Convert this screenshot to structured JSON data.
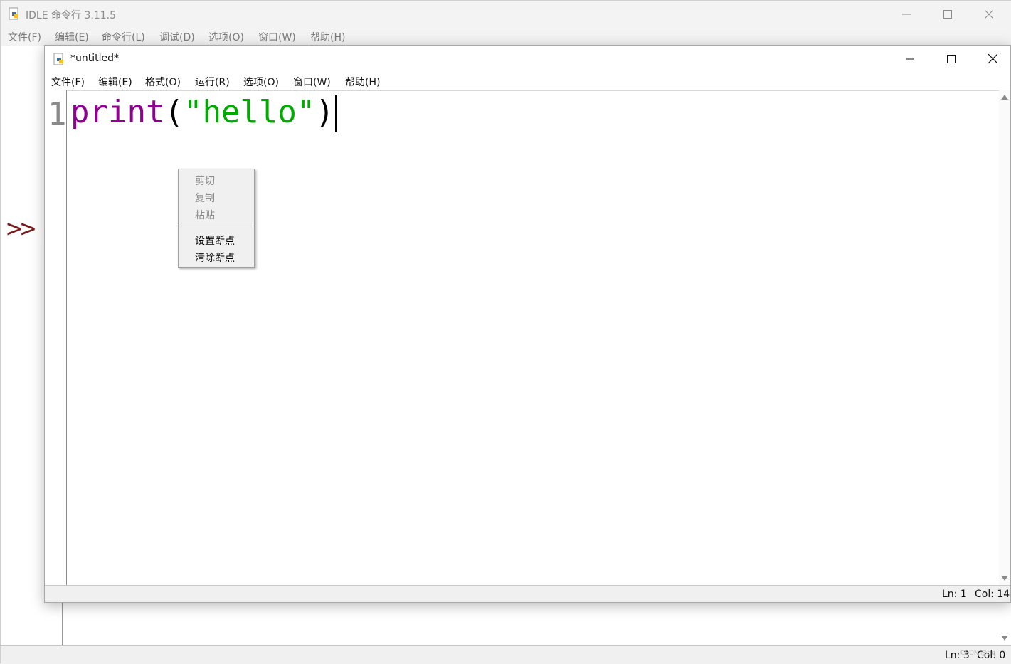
{
  "shell_window": {
    "title": "IDLE 命令行 3.11.5",
    "menu": [
      "文件(F)",
      "编辑(E)",
      "命令行(L)",
      "调试(D)",
      "选项(O)",
      "窗口(W)",
      "帮助(H)"
    ],
    "prompt": ">>",
    "status": {
      "ln": "Ln: 3",
      "col": "Col: 0"
    }
  },
  "editor_window": {
    "title": "*untitled*",
    "menu": [
      "文件(F)",
      "编辑(E)",
      "格式(O)",
      "运行(R)",
      "选项(O)",
      "窗口(W)",
      "帮助(H)"
    ],
    "line_number": "1",
    "code": {
      "builtin": "print",
      "open_paren": "(",
      "string": "\"hello\"",
      "close_paren": ")"
    },
    "status": {
      "ln": "Ln: 1",
      "col": "Col: 14"
    }
  },
  "context_menu": {
    "items_disabled": [
      "剪切",
      "复制",
      "粘贴"
    ],
    "items_enabled": [
      "设置断点",
      "清除断点"
    ]
  },
  "watermark": "CSDN @qq"
}
